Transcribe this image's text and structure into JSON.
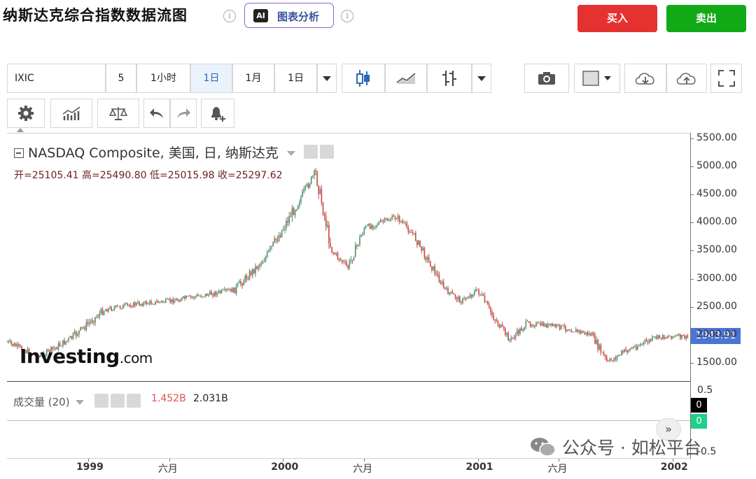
{
  "header": {
    "title": "纳斯达克综合指数数据流图",
    "ai_label": "图表分析",
    "ai_logo": "AI",
    "buy_label": "买入",
    "sell_label": "卖出",
    "info_glyph": "i"
  },
  "toolbar": {
    "symbol": "IXIC",
    "intervals": [
      "5",
      "1小时",
      "1日",
      "1月",
      "1日"
    ],
    "active_interval_index": 2
  },
  "chart": {
    "legend_title": "NASDAQ Composite, 美国, 日, 纳斯达克",
    "ohlc": {
      "open_label": "开=",
      "open": "25105.41",
      "high_label": "高=",
      "high": "25490.80",
      "low_label": "低=",
      "low": "25015.98",
      "close_label": "收=",
      "close": "25297.62"
    },
    "last_price": "1943.91",
    "watermark_main": "Investing",
    "watermark_suffix": ".com",
    "volume_label": "成交量 (20)",
    "volume_value_a": "1.452B",
    "volume_value_b": "2.031B",
    "volume_axis": [
      "0.5",
      "-0.5"
    ],
    "badge_black": "0",
    "badge_green": "0",
    "wechat_watermark": "公众号 · 如松平台",
    "scroll_glyph": "»"
  },
  "chart_data": {
    "type": "line",
    "title": "NASDAQ Composite, 美国, 日, 纳斯达克",
    "y_ticks": [
      "5500.00",
      "5000.00",
      "4500.00",
      "4000.00",
      "3500.00",
      "3000.00",
      "2500.00",
      "2000.00",
      "1500.00"
    ],
    "ylim": [
      1200,
      5500
    ],
    "x_tick_labels": [
      "1999",
      "六月",
      "2000",
      "六月",
      "2001",
      "六月",
      "2002"
    ],
    "x": [
      "1998-08",
      "1998-10",
      "1998-12",
      "1999-02",
      "1999-04",
      "1999-06",
      "1999-08",
      "1999-10",
      "1999-12",
      "2000-02",
      "2000-03",
      "2000-04",
      "2000-05",
      "2000-06",
      "2000-08",
      "2000-09",
      "2000-10",
      "2000-11",
      "2000-12",
      "2001-01",
      "2001-02",
      "2001-03",
      "2001-04",
      "2001-06",
      "2001-08",
      "2001-09",
      "2001-10",
      "2001-12",
      "2002-01",
      "2002-02"
    ],
    "series": [
      {
        "values": [
          1870,
          1600,
          1950,
          2450,
          2550,
          2600,
          2700,
          2800,
          3400,
          4400,
          4900,
          3500,
          3200,
          3900,
          4100,
          3800,
          3300,
          2800,
          2600,
          2800,
          2300,
          1900,
          2200,
          2150,
          2000,
          1500,
          1700,
          1950,
          1980,
          1943.91
        ]
      }
    ]
  }
}
